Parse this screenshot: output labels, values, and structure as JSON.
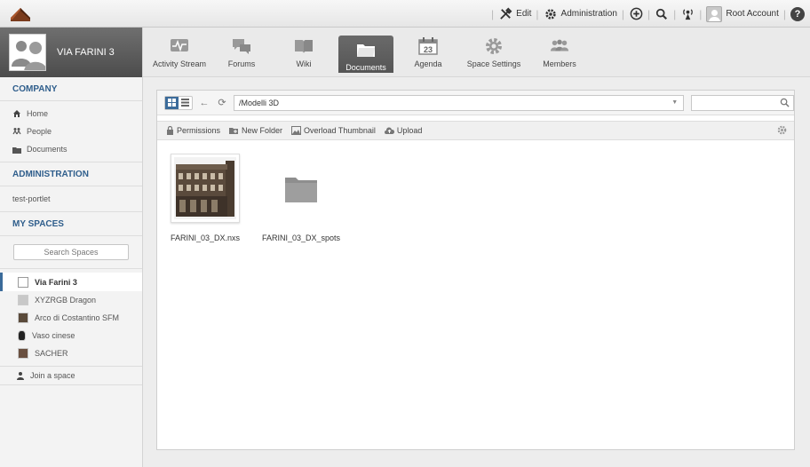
{
  "topbar": {
    "edit_label": "Edit",
    "administration_label": "Administration",
    "account_label": "Root Account",
    "help_glyph": "?"
  },
  "sidebar": {
    "space_name": "VIA FARINI 3",
    "company_title": "COMPANY",
    "company_items": [
      {
        "label": "Home",
        "icon": "home-icon"
      },
      {
        "label": "People",
        "icon": "people-icon"
      },
      {
        "label": "Documents",
        "icon": "folder-icon"
      }
    ],
    "administration_title": "ADMINISTRATION",
    "administration_items": [
      {
        "label": "test-portlet"
      }
    ],
    "myspaces_title": "MY SPACES",
    "search_placeholder": "Search Spaces",
    "spaces": [
      {
        "label": "Via Farini 3",
        "active": true
      },
      {
        "label": "XYZRGB Dragon",
        "active": false
      },
      {
        "label": "Arco di Costantino SFM",
        "active": false
      },
      {
        "label": "Vaso cinese",
        "active": false
      },
      {
        "label": "SACHER",
        "active": false
      }
    ],
    "join_label": "Join a space"
  },
  "apps": [
    {
      "label": "Activity Stream",
      "icon": "activity-icon",
      "active": false
    },
    {
      "label": "Forums",
      "icon": "forums-icon",
      "active": false
    },
    {
      "label": "Wiki",
      "icon": "wiki-icon",
      "active": false
    },
    {
      "label": "Documents",
      "icon": "documents-icon",
      "active": true
    },
    {
      "label": "Agenda",
      "icon": "calendar-icon",
      "active": false,
      "day": "23"
    },
    {
      "label": "Space Settings",
      "icon": "settings-icon",
      "active": false
    },
    {
      "label": "Members",
      "icon": "members-icon",
      "active": false
    }
  ],
  "documents": {
    "path": "/Modelli 3D",
    "actions": {
      "permissions": "Permissions",
      "new_folder": "New Folder",
      "overload_thumbnail": "Overload Thumbnail",
      "upload": "Upload"
    },
    "files": [
      {
        "name": "FARINI_03_DX.nxs",
        "type": "file"
      },
      {
        "name": "FARINI_03_DX_spots",
        "type": "folder"
      }
    ]
  },
  "colors": {
    "accent": "#3b6b9a",
    "section_title": "#2f5e8c",
    "active_app_bg": "#5f5f5f"
  }
}
